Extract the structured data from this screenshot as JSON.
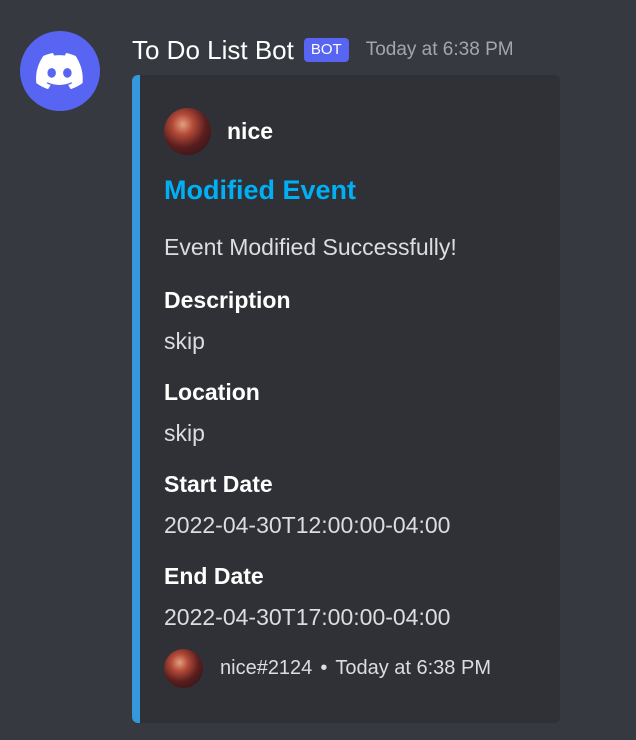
{
  "message": {
    "author": "To Do List Bot",
    "bot_tag": "BOT",
    "timestamp": "Today at 6:38 PM",
    "avatar_icon": "discord-logo-icon"
  },
  "embed": {
    "accent_color": "#3498db",
    "author_name": "nice",
    "title": "Modified Event",
    "description": "Event Modified Successfully!",
    "fields": [
      {
        "name": "Description",
        "value": "skip"
      },
      {
        "name": "Location",
        "value": "skip"
      },
      {
        "name": "Start Date",
        "value": "2022-04-30T12:00:00-04:00"
      },
      {
        "name": "End Date",
        "value": "2022-04-30T17:00:00-04:00"
      }
    ],
    "footer": {
      "text": "nice#2124",
      "separator": "•",
      "timestamp": "Today at 6:38 PM"
    }
  },
  "colors": {
    "background": "#36393f",
    "embed_background": "#2f3136",
    "bot_tag": "#5865f2",
    "title_link": "#00aff4"
  }
}
